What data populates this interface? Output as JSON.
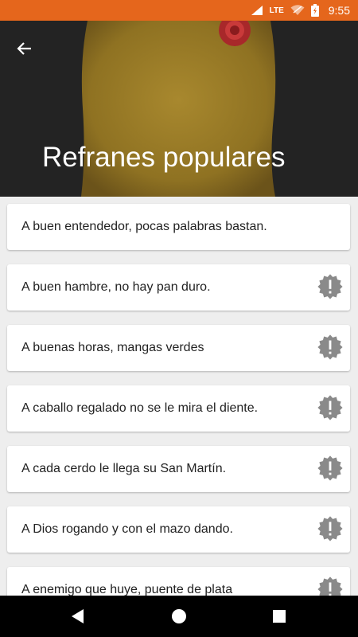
{
  "status_bar": {
    "network": "LTE",
    "time": "9:55",
    "colors": {
      "background": "#e5661c"
    },
    "icons": [
      "wifi-icon",
      "signal-icon",
      "battery-icon"
    ]
  },
  "header": {
    "title": "Refranes populares",
    "back_icon": "arrow-back-icon",
    "background_color": "#232323"
  },
  "proverbs": [
    {
      "text": "A buen entendedor, pocas palabras bastan.",
      "has_badge": false
    },
    {
      "text": "A buen hambre, no hay pan duro.",
      "has_badge": true
    },
    {
      "text": "A buenas horas, mangas verdes",
      "has_badge": true
    },
    {
      "text": "A caballo regalado no se le mira el diente.",
      "has_badge": true
    },
    {
      "text": "A cada cerdo le llega su San Martín.",
      "has_badge": true
    },
    {
      "text": "A Dios rogando y con el mazo dando.",
      "has_badge": true
    },
    {
      "text": "A enemigo que huye, puente de plata",
      "has_badge": true
    }
  ],
  "badge_icon": "alert-badge-icon",
  "nav_bar": {
    "buttons": [
      "back-triangle-icon",
      "home-circle-icon",
      "recents-square-icon"
    ]
  }
}
